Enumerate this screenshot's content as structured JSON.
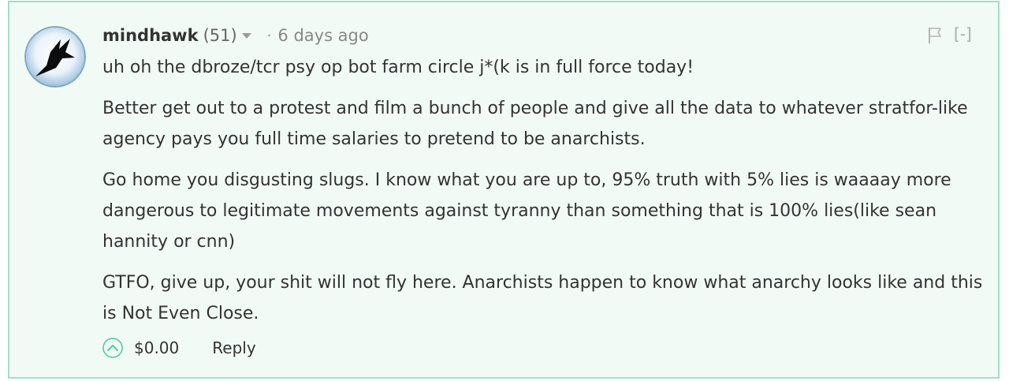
{
  "comment": {
    "author": "mindhawk",
    "reputation": "(51)",
    "separator": "·",
    "timestamp": "6 days ago",
    "collapse_label": "[-]",
    "paragraphs": [
      "uh oh the dbroze/tcr psy op bot farm circle j*(k is in full force today!",
      "Better get out to a protest and film a bunch of people and give all the data to whatever stratfor-like agency pays you full time salaries to pretend to be anarchists.",
      "Go home you disgusting slugs. I know what you are up to, 95% truth with 5% lies is waaaay more dangerous to legitimate movements against tyranny than something that is 100% lies(like sean hannity or cnn)",
      "GTFO, give up, your shit will not fly here. Anarchists happen to know what anarchy looks like and this is Not Even Close."
    ],
    "payout": "$0.00",
    "reply_label": "Reply"
  },
  "icons": {
    "avatar": "bird-silhouette-avatar",
    "caret": "caret-down-icon",
    "flag": "flag-icon",
    "upvote": "upvote-chevron-icon"
  },
  "colors": {
    "card_background": "#f2faf6",
    "card_border": "#9fe0c4",
    "upvote_accent": "#4ccda0",
    "text": "#333333",
    "muted": "#888888"
  }
}
